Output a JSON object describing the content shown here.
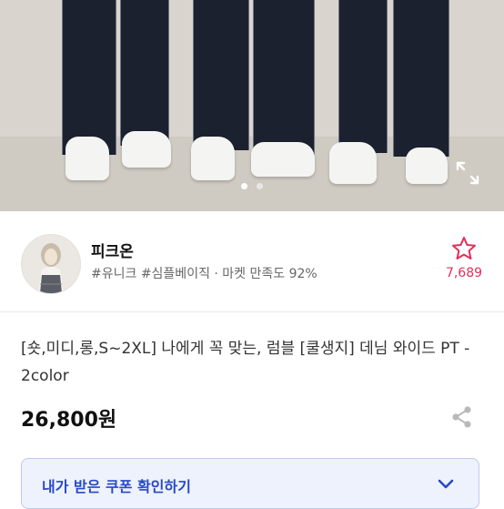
{
  "carousel": {
    "total_images": 2,
    "active_index": 0
  },
  "seller": {
    "name": "피크온",
    "tags": "#유니크 #심플베이직 · 마켓 만족도 92%",
    "like_count": "7,689"
  },
  "product": {
    "title": "[숏,미디,롱,S~2XL] 나에게 꼭 맞는, 럼블 [쿨생지] 데님 와이드 PT - 2color",
    "price": "26,800원"
  },
  "coupon": {
    "label": "내가 받은 쿠폰 확인하기"
  },
  "colors": {
    "accent_blue": "#2848c8",
    "like_pink": "#e0305b",
    "denim": "#1c2130"
  },
  "icons": [
    "expand-icon",
    "star-icon",
    "share-icon",
    "chevron-down-icon"
  ]
}
